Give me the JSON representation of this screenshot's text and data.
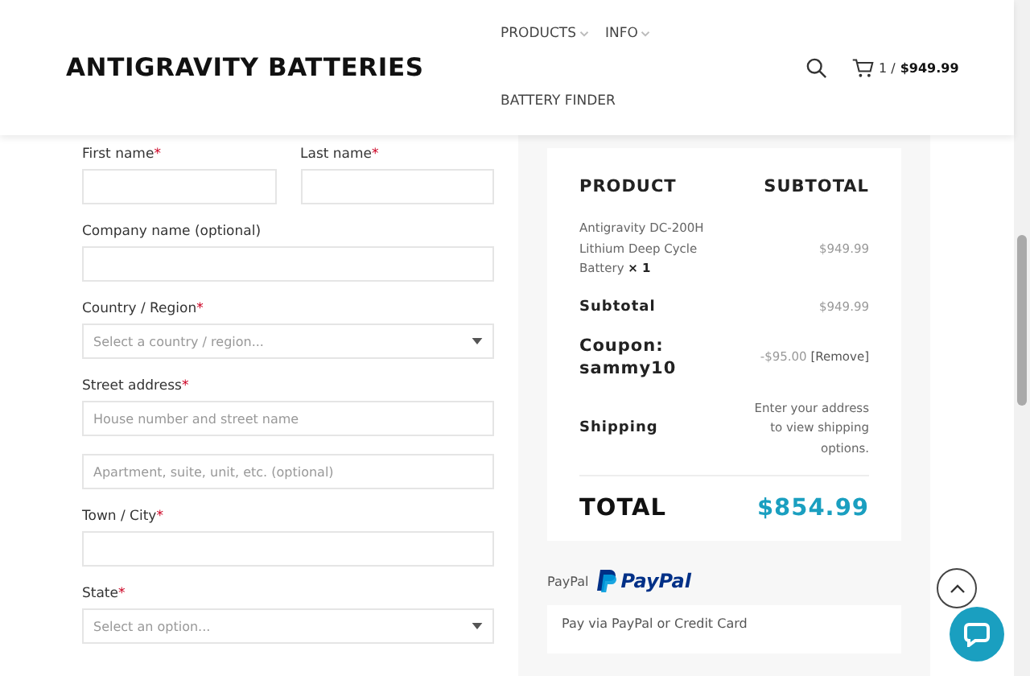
{
  "header": {
    "logo": "ANTIGRAVITY BATTERIES",
    "nav": [
      {
        "label": "PRODUCTS",
        "dropdown": true
      },
      {
        "label": "INFO",
        "dropdown": true
      },
      {
        "label": "BATTERY FINDER",
        "dropdown": false
      }
    ],
    "cart": {
      "count": "1 /",
      "total": "$949.99"
    }
  },
  "form": {
    "rows": [
      [
        {
          "label": "First name",
          "marker": "*",
          "kind": "text"
        },
        {
          "label": "Last name",
          "marker": "*",
          "kind": "text"
        }
      ],
      [
        {
          "label": "Company name (optional)",
          "kind": "text"
        }
      ],
      [
        {
          "label": "Country / Region",
          "marker": "*",
          "kind": "select",
          "placeholder": "Select a country / region..."
        }
      ],
      [
        {
          "label": "Street address",
          "marker": "*",
          "kind": "text",
          "placeholder": "House number and street name"
        }
      ],
      [
        {
          "kind": "text",
          "placeholder": "Apartment, suite, unit, etc. (optional)"
        }
      ],
      [
        {
          "label": "Town / City",
          "marker": "*",
          "kind": "text"
        }
      ],
      [
        {
          "label": "State",
          "marker": "*",
          "kind": "select",
          "placeholder": "Select an option..."
        }
      ]
    ]
  },
  "order": {
    "columns": [
      "PRODUCT",
      "SUBTOTAL"
    ],
    "item": {
      "name": "Antigravity DC-200H Lithium Deep Cycle Battery",
      "quantity": "× 1",
      "price": "$949.99"
    },
    "subtotal": {
      "label": "Subtotal",
      "value": "$949.99"
    },
    "coupon": {
      "label": "Coupon: sammy10",
      "amount": "-$95.00",
      "remove": "[Remove]"
    },
    "shipping": {
      "label": "Shipping",
      "note": "Enter your address to view shipping options."
    },
    "total": {
      "label": "TOTAL",
      "value": "$854.99"
    }
  },
  "payment": {
    "method": "PayPal",
    "logo": "PayPal",
    "description": "Pay via PayPal or Credit Card"
  }
}
